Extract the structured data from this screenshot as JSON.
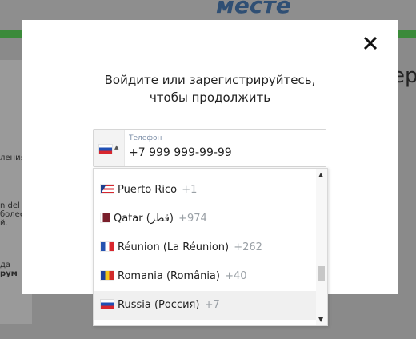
{
  "background": {
    "banner_title": "месте",
    "left_snippets": [
      "ления",
      "n del",
      "более",
      "й.",
      "да",
      "рум"
    ],
    "right_snippet": "ер"
  },
  "modal": {
    "title": "Войдите или зарегистрируйтесь,\nчтобы продолжить",
    "close_icon": "close-icon",
    "phone": {
      "label": "Телефон",
      "placeholder": "+7 999 999-99-99",
      "selected_country": "Russia",
      "arrow": "▲"
    }
  },
  "dropdown": {
    "items": [
      {
        "name": "Puerto Rico",
        "dial": "+1",
        "flag": "pr"
      },
      {
        "name": "Qatar (قطر)",
        "dial": "+974",
        "flag": "qa"
      },
      {
        "name": "Réunion (La Réunion)",
        "dial": "+262",
        "flag": "re"
      },
      {
        "name": "Romania (România)",
        "dial": "+40",
        "flag": "ro"
      },
      {
        "name": "Russia (Россия)",
        "dial": "+7",
        "flag": "ru"
      }
    ],
    "scroll_up": "▲",
    "scroll_down": "▼"
  }
}
